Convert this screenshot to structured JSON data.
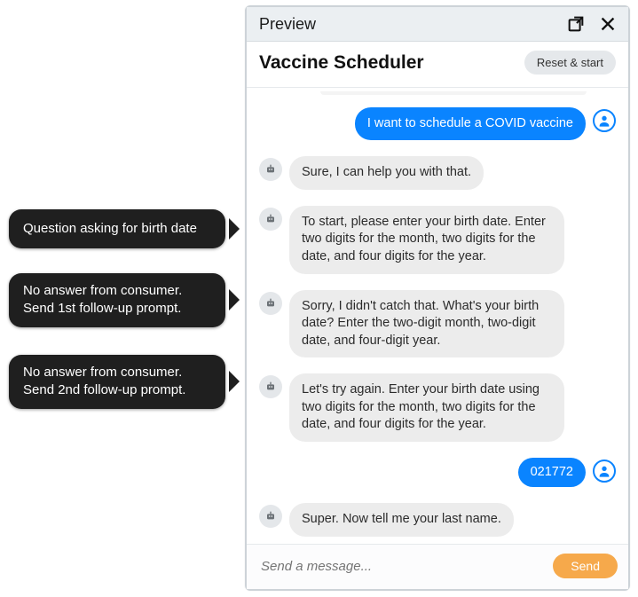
{
  "annotations": {
    "a1": "Question asking for birth date",
    "a2_line1": "No answer from consumer.",
    "a2_line2": "Send 1st follow-up prompt.",
    "a3_line1": "No answer from consumer.",
    "a3_line2": "Send 2nd follow-up prompt."
  },
  "panel": {
    "preview_label": "Preview",
    "app_title": "Vaccine Scheduler",
    "reset_label": "Reset & start"
  },
  "composer": {
    "placeholder": "Send a message...",
    "send_label": "Send"
  },
  "chat": {
    "m1_user": "I want to schedule a COVID vaccine",
    "m2_bot": "Sure, I can help you with that.",
    "m3_bot": "To start, please enter your birth date. Enter two digits for the month, two digits for the date, and four digits for the year.",
    "m4_bot": "Sorry, I didn't catch that. What's your birth date? Enter the two-digit month, two-digit date, and four-digit year.",
    "m5_bot": "Let's try again. Enter your birth date using two digits for the month, two digits for the date, and four digits for the year.",
    "m6_user": "021772",
    "m7_bot": "Super. Now tell me your last name."
  },
  "icons": {
    "popout": "popout-icon",
    "close": "close-icon",
    "bot": "bot-avatar-icon",
    "user": "user-avatar-icon"
  }
}
